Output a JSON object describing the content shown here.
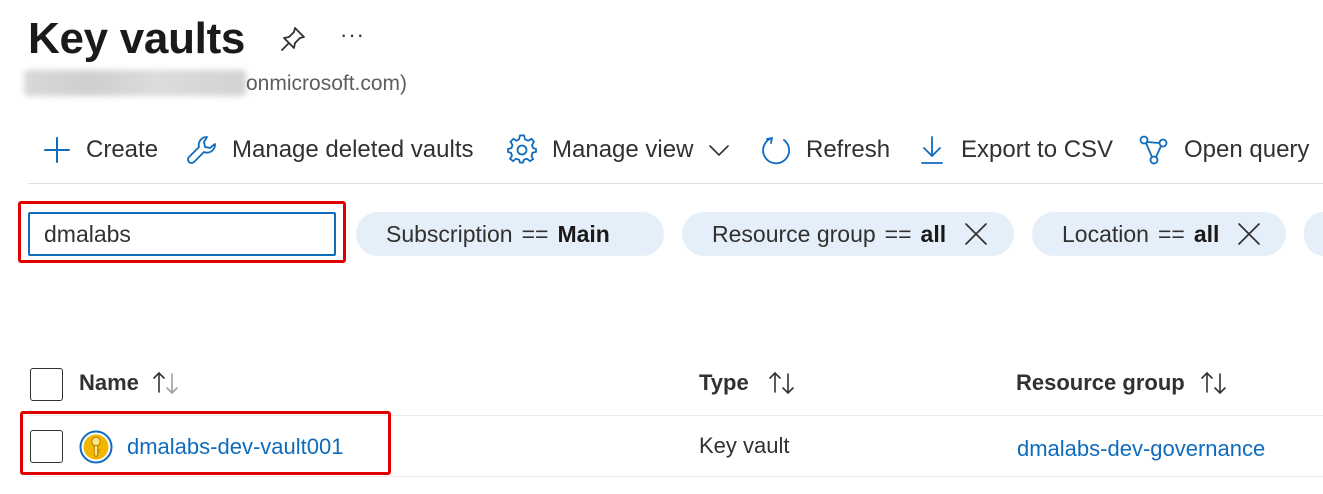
{
  "header": {
    "title": "Key vaults",
    "tenant_visible": "onmicrosoft.com)",
    "pin_icon": "pin-icon",
    "more_icon": "ellipsis-icon",
    "more_label": "···"
  },
  "toolbar": {
    "create": "Create",
    "manage_deleted": "Manage deleted vaults",
    "manage_view": "Manage view",
    "refresh": "Refresh",
    "export_csv": "Export to CSV",
    "open_query": "Open query"
  },
  "filter": {
    "search_value": "dmalabs",
    "pills": [
      {
        "key": "Subscription",
        "op": "==",
        "value": "Main",
        "removable": false
      },
      {
        "key": "Resource group",
        "op": "==",
        "value": "all",
        "removable": true
      },
      {
        "key": "Location",
        "op": "==",
        "value": "all",
        "removable": true
      }
    ]
  },
  "table": {
    "columns": [
      "Name",
      "Type",
      "Resource group"
    ],
    "rows": [
      {
        "name": "dmalabs-dev-vault001",
        "type": "Key vault",
        "resource_group": "dmalabs-dev-governance",
        "icon": "key-vault-icon"
      }
    ]
  },
  "colors": {
    "accent": "#0f6cbd",
    "highlight": "#e00000",
    "pill_bg": "#e4eff9",
    "key_icon_bg": "#f2b600"
  }
}
